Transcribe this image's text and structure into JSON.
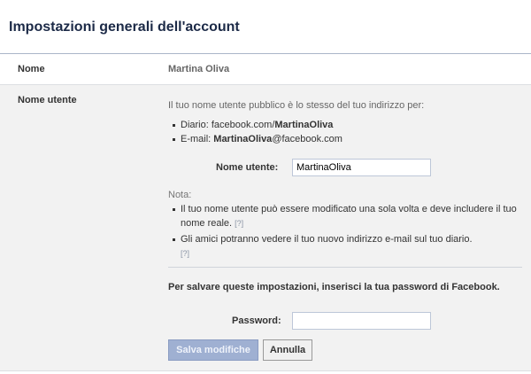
{
  "header": {
    "title": "Impostazioni generali dell'account"
  },
  "name_row": {
    "label": "Nome",
    "value": "Martina Oliva"
  },
  "username_row": {
    "label": "Nome utente",
    "intro": "Il tuo nome utente pubblico è lo stesso del tuo indirizzo per:",
    "diary_prefix": "Diario: facebook.com/",
    "diary_user": "MartinaOliva",
    "email_prefix": "E-mail: ",
    "email_user": "MartinaOliva",
    "email_suffix": "@facebook.com",
    "field_label": "Nome utente:",
    "field_value": "MartinaOliva",
    "note_title": "Nota:",
    "note1": "Il tuo nome utente può essere modificato una sola volta e deve includere il tuo nome reale.",
    "note1_help": "[?]",
    "note2": "Gli amici potranno vedere il tuo nuovo indirizzo e-mail sul tuo diario.",
    "note2_help": "[?]",
    "save_info": "Per salvare queste impostazioni, inserisci la tua password di Facebook.",
    "password_label": "Password:",
    "password_value": "",
    "save_button": "Salva modifiche",
    "cancel_button": "Annulla"
  }
}
